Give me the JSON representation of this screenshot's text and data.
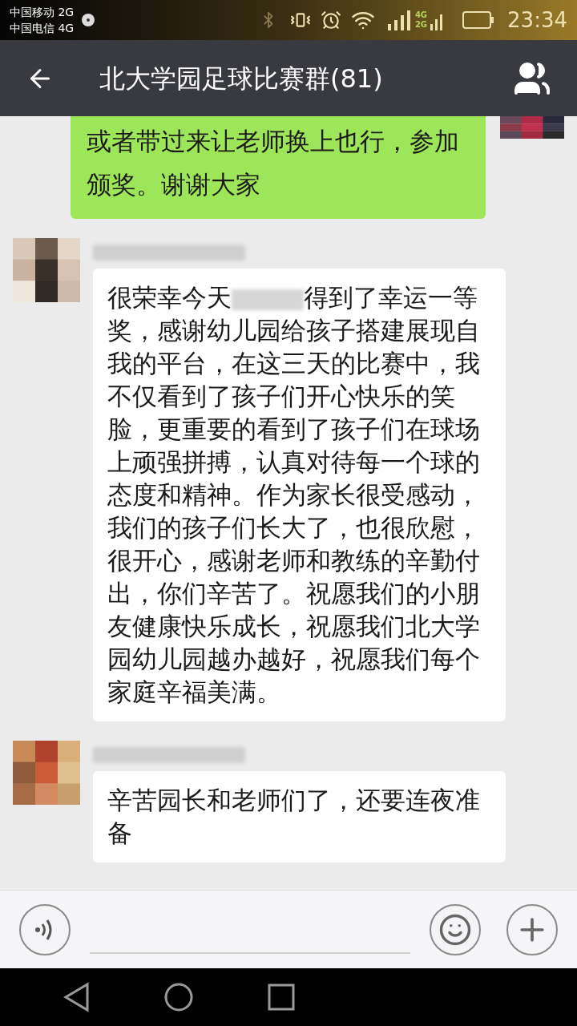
{
  "status_bar": {
    "carriers": [
      "中国移动 2G",
      "中国电信 4G"
    ],
    "network_labels": [
      "4G",
      "2G"
    ],
    "time": "23:34"
  },
  "title_bar": {
    "title": "北大学园足球比赛群(81)"
  },
  "messages": [
    {
      "kind": "outgoing",
      "lines": [
        "或者带过来让老师换上也行，参加颁奖。谢谢大家"
      ]
    },
    {
      "kind": "incoming",
      "sender_blurred": true,
      "text_before_blur": "很荣幸今天",
      "text_after_blur": "得到了幸运一等奖，感谢幼儿园给孩子搭建展现自我的平台，在这三天的比赛中，我不仅看到了孩子们开心快乐的笑脸，更重要的看到了孩子们在球场上顽强拼搏，认真对待每一个球的态度和精神。作为家长很受感动，我们的孩子们长大了，也很欣慰，很开心，感谢老师和教练的辛勤付出，你们辛苦了。祝愿我们的小朋友健康快乐成长，祝愿我们北大学园幼儿园越办越好，祝愿我们每个家庭辛福美满。"
    },
    {
      "kind": "incoming",
      "sender_blurred": true,
      "text_before_blur": "辛苦园长和老师们了，还要连夜准备"
    }
  ]
}
